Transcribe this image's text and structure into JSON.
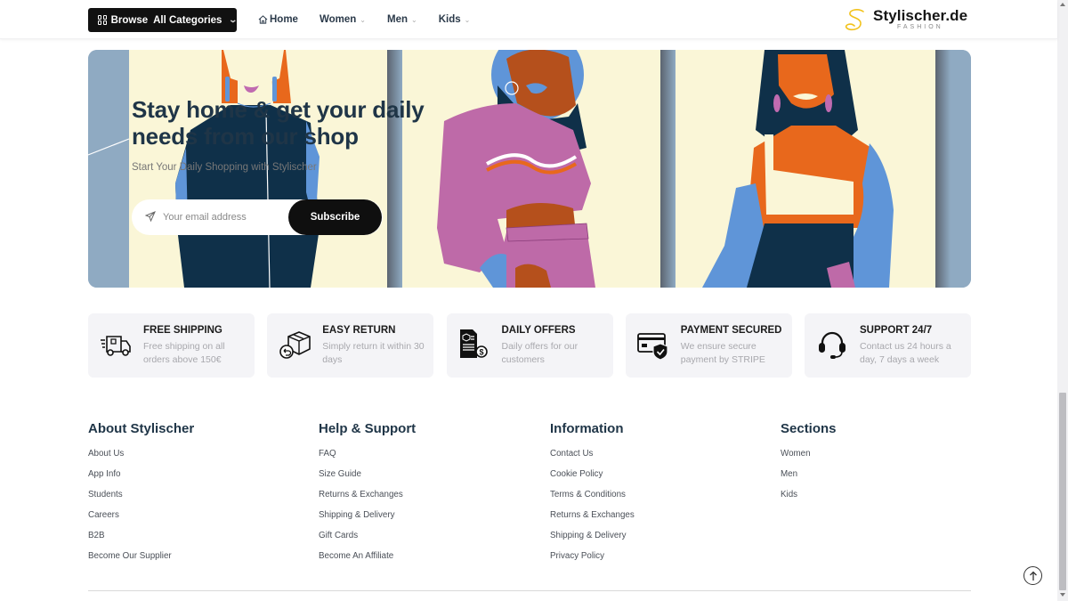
{
  "header": {
    "browse_label": "Browse  All Categories",
    "nav": [
      {
        "label": "Home",
        "icon": "home-icon",
        "has_dropdown": false
      },
      {
        "label": "Women",
        "has_dropdown": true
      },
      {
        "label": "Men",
        "has_dropdown": true
      },
      {
        "label": "Kids",
        "has_dropdown": true
      }
    ],
    "logo": {
      "name": "Stylischer.de",
      "tagline": "FASHION"
    }
  },
  "hero": {
    "title_line1": "Stay home & get your daily",
    "title_line2": "needs from our shop",
    "subtitle": "Start Your Daily Shopping with Stylischer",
    "email_placeholder": "Your email address",
    "email_value": "",
    "subscribe_label": "Subscribe"
  },
  "features": [
    {
      "icon": "delivery-truck-icon",
      "title": "FREE SHIPPING",
      "desc": "Free shipping on all orders above 150€"
    },
    {
      "icon": "return-box-icon",
      "title": "EASY RETURN",
      "desc": "Simply return it within 30 days"
    },
    {
      "icon": "daily-offers-icon",
      "title": "DAILY OFFERS",
      "desc": "Daily offers for our customers"
    },
    {
      "icon": "secure-payment-icon",
      "title": "PAYMENT SECURED",
      "desc": "We ensure secure payment by STRIPE"
    },
    {
      "icon": "headset-support-icon",
      "title": "SUPPORT 24/7",
      "desc": "Contact us 24 hours a day, 7 days a week"
    }
  ],
  "footer": {
    "columns": [
      {
        "title": "About Stylischer",
        "links": [
          "About Us",
          "App Info",
          "Students",
          "Careers",
          "B2B",
          "Become Our Supplier"
        ]
      },
      {
        "title": "Help & Support",
        "links": [
          "FAQ",
          "Size Guide",
          "Returns & Exchanges",
          "Shipping & Delivery",
          "Gift Cards",
          "Become An Affiliate"
        ]
      },
      {
        "title": "Information",
        "links": [
          "Contact Us",
          "Cookie Policy",
          "Terms & Conditions",
          "Returns & Exchanges",
          "Shipping & Delivery",
          "Privacy Policy"
        ]
      },
      {
        "title": "Sections",
        "links": [
          "Women",
          "Men",
          "Kids"
        ]
      }
    ]
  },
  "colors": {
    "primary_dark": "#111111",
    "heading": "#1f3547",
    "hero_bg": "#faf6d7",
    "feature_bg": "#f4f4f7",
    "logo_accent": "#f2c21b"
  }
}
